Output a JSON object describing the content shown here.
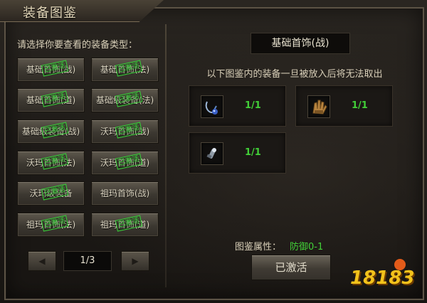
{
  "title": "装备图鉴",
  "prompt": "请选择你要查看的装备类型：",
  "stamp_text": "已激活",
  "categories": [
    {
      "label": "基础首饰(战)",
      "activated": true
    },
    {
      "label": "基础首饰(法)",
      "activated": true
    },
    {
      "label": "基础首饰(道)",
      "activated": true
    },
    {
      "label": "基础级装备(法)",
      "activated": true
    },
    {
      "label": "基础级装备(战)",
      "activated": true
    },
    {
      "label": "沃玛首饰(战)",
      "activated": true
    },
    {
      "label": "沃玛首饰(法)",
      "activated": true
    },
    {
      "label": "沃玛首饰(道)",
      "activated": true
    },
    {
      "label": "沃玛级装备",
      "activated": true
    },
    {
      "label": "祖玛首饰(战)",
      "activated": false
    },
    {
      "label": "祖玛首饰(法)",
      "activated": true
    },
    {
      "label": "祖玛首饰(道)",
      "activated": true
    }
  ],
  "pagination": {
    "current": "1/3"
  },
  "detail": {
    "title": "基础首饰(战)",
    "notice": "以下图鉴内的装备一旦被放入后将无法取出",
    "slots": [
      {
        "count": "1/1",
        "icon": "necklace-icon"
      },
      {
        "count": "1/1",
        "icon": "bracelet-icon"
      },
      {
        "count": "1/1",
        "icon": "ring-icon"
      }
    ],
    "attribute_label": "图鉴属性：",
    "attribute_value": "防御0-1",
    "button_label": "已激活"
  },
  "watermark": "18183",
  "colors": {
    "stamp": "#39d23a",
    "count": "#42d038",
    "logo": "#f2c21b"
  }
}
